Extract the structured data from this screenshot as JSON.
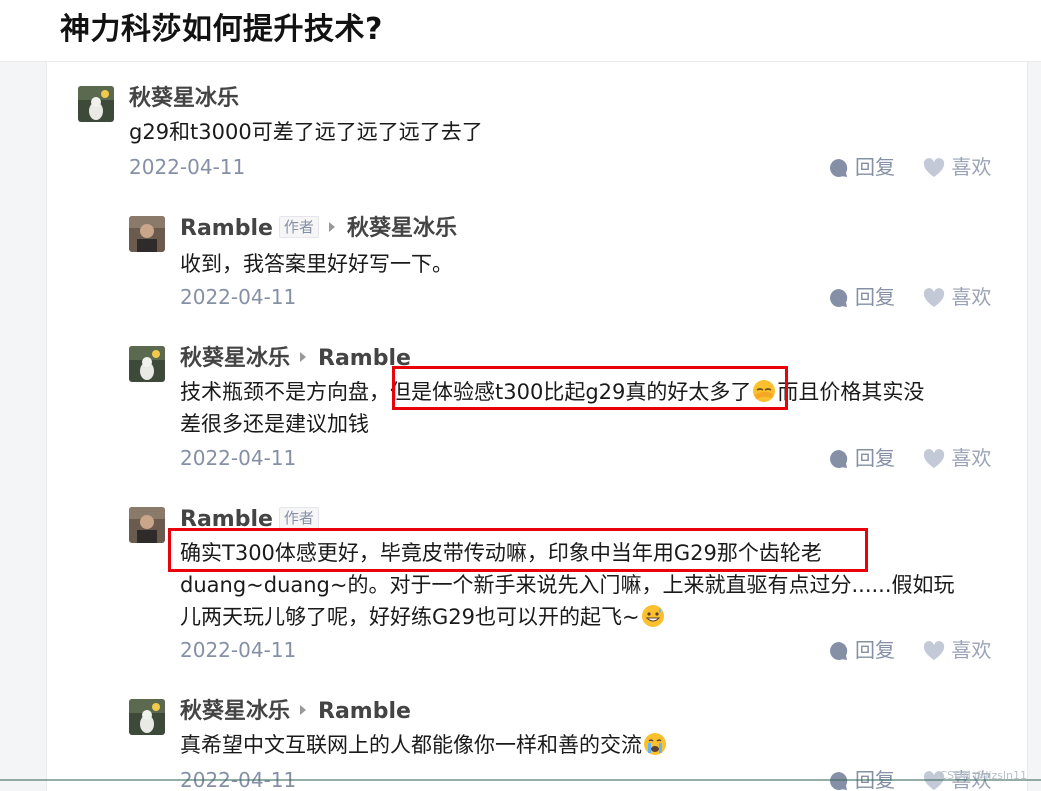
{
  "question": {
    "title": "神力科莎如何提升技术?"
  },
  "colors": {
    "highlight": "#e8020b",
    "meta_text": "#8590a6",
    "name_text": "#444444"
  },
  "actions": {
    "reply": "回复",
    "like": "喜欢"
  },
  "comments": [
    {
      "author": "秋葵星冰乐",
      "lines": [
        "g29和t3000可差了远了远了远了去了"
      ],
      "date": "2022-04-11"
    },
    {
      "author": "Ramble",
      "author_tag": "作者",
      "reply_to": "秋葵星冰乐",
      "lines": [
        "收到，我答案里好好写一下。"
      ],
      "date": "2022-04-11"
    },
    {
      "author": "秋葵星冰乐",
      "reply_to": "Ramble",
      "line1_pre": "技术瓶颈不是方向盘，",
      "line1_highlight": "但是体验感t300比起g29真的好太多了",
      "line1_emoji": "face-palm-emoji",
      "line1_post": "而且价格其实没",
      "line2": "差很多还是建议加钱",
      "date": "2022-04-11"
    },
    {
      "author": "Ramble",
      "author_tag": "作者",
      "line1_highlight": "确实T300体感更好，毕竟皮带传动嘛，印象中当年用G29那个齿轮老",
      "line2": "duang~duang~的。对于一个新手来说先入门嘛，上来就直驱有点过分......假如玩",
      "line3": "儿两天玩儿够了呢，好好练G29也可以开的起飞~",
      "line3_emoji": "grin-sweat-emoji",
      "date": "2022-04-11"
    },
    {
      "author": "秋葵星冰乐",
      "reply_to": "Ramble",
      "line1": "真希望中文互联网上的人都能像你一样和善的交流",
      "line1_emoji": "crying-emoji",
      "date": "2022-04-11"
    }
  ],
  "watermark": "CSDN @lizsln11"
}
